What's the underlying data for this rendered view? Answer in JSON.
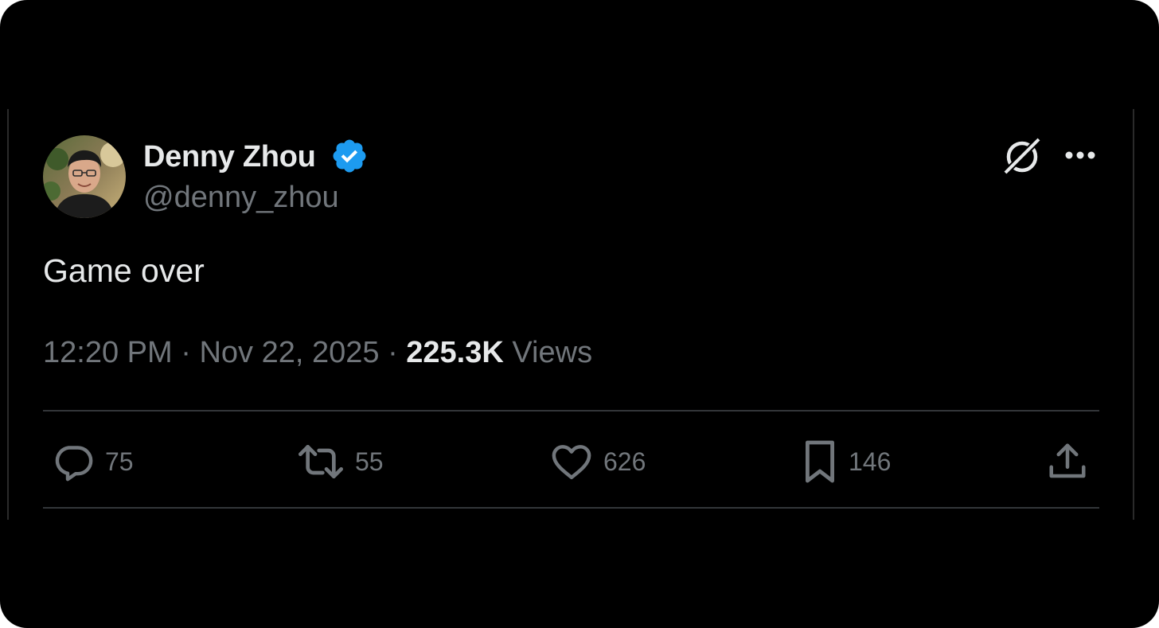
{
  "author": {
    "name": "Denny Zhou",
    "handle": "@denny_zhou",
    "verified": true,
    "avatar_icon": "profile-photo"
  },
  "tweet": {
    "text": "Game over",
    "time": "12:20 PM",
    "date": "Nov 22, 2025",
    "separator": "·",
    "views_count": "225.3K",
    "views_label": "Views"
  },
  "header_icons": [
    "grok-icon",
    "more-options-icon"
  ],
  "actions": {
    "reply": {
      "icon": "reply-icon",
      "count": "75"
    },
    "retweet": {
      "icon": "retweet-icon",
      "count": "55"
    },
    "like": {
      "icon": "heart-icon",
      "count": "626"
    },
    "bookmark": {
      "icon": "bookmark-icon",
      "count": "146"
    },
    "share": {
      "icon": "share-icon"
    }
  },
  "colors": {
    "background": "#000000",
    "text_primary": "#e7e9ea",
    "text_secondary": "#71767b",
    "verified_blue": "#1d9bf0",
    "divider": "#333639"
  }
}
